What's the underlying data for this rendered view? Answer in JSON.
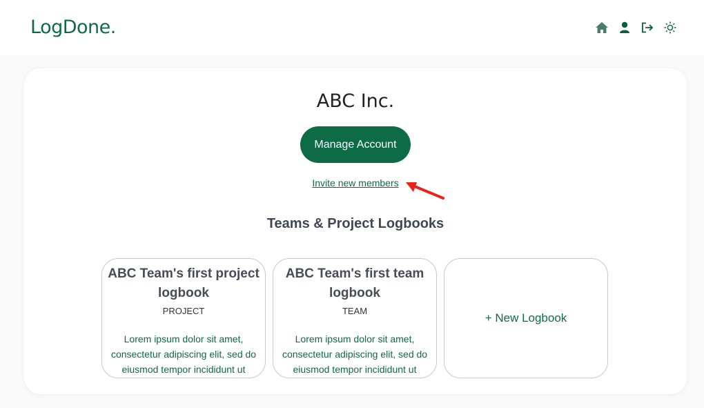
{
  "header": {
    "logo": "LogDone.",
    "icons": [
      "home-icon",
      "user-icon",
      "logout-icon",
      "sun-icon"
    ],
    "accent_color": "#0d6b46"
  },
  "organization": {
    "name": "ABC Inc.",
    "manage_label": "Manage Account",
    "invite_label": "Invite new members"
  },
  "section": {
    "title": "Teams & Project Logbooks"
  },
  "logbooks": [
    {
      "title": "ABC Team's first project logbook",
      "type": "PROJECT",
      "description": "Lorem ipsum dolor sit amet, consectetur adipiscing elit, sed do eiusmod tempor incididunt ut labore."
    },
    {
      "title": "ABC Team's first team logbook",
      "type": "TEAM",
      "description": "Lorem ipsum dolor sit amet, consectetur adipiscing elit, sed do eiusmod tempor incididunt ut labore."
    }
  ],
  "new_logbook_label": "+ New Logbook"
}
